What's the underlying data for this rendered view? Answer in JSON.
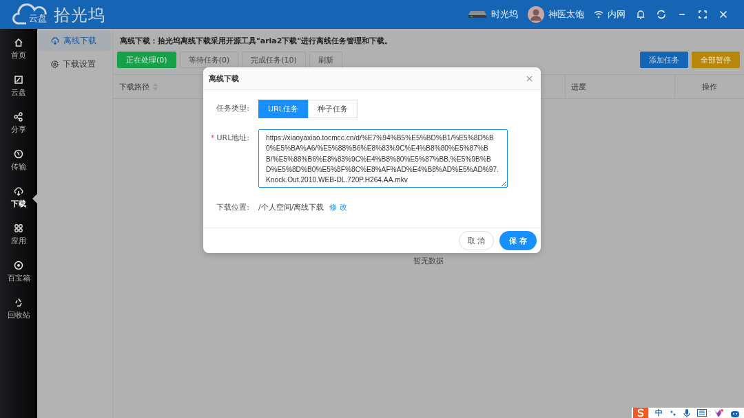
{
  "header": {
    "logo_sub": "云盘",
    "logo_title": "拾光坞",
    "device": "时光坞",
    "user": "神医太饱",
    "network": "内网"
  },
  "nav": [
    {
      "label": "首页",
      "selected": false
    },
    {
      "label": "云盘",
      "selected": false
    },
    {
      "label": "分享",
      "selected": false
    },
    {
      "label": "传输",
      "selected": false
    },
    {
      "label": "下载",
      "selected": true
    },
    {
      "label": "应用",
      "selected": false
    },
    {
      "label": "百宝箱",
      "selected": false
    },
    {
      "label": "回收站",
      "selected": false
    }
  ],
  "subnav": [
    {
      "label": "离线下载",
      "selected": true
    },
    {
      "label": "下载设置",
      "selected": false
    }
  ],
  "description": "离线下载：拾光坞离线下载采用开源工具\"aria2下载\"进行离线任务管理和下载。",
  "filters": [
    {
      "label": "正在处理(0)",
      "selected": true
    },
    {
      "label": "等待任务(0)",
      "selected": false
    },
    {
      "label": "完成任务(10)",
      "selected": false
    }
  ],
  "refresh_button": "刷新",
  "actions": [
    {
      "label": "添加任务",
      "kind": "primary"
    },
    {
      "label": "全部暂停",
      "kind": "warning"
    }
  ],
  "table": {
    "columns": [
      "下载路径",
      "进度",
      "操作"
    ],
    "empty_text": "暂无数据"
  },
  "dialog": {
    "title": "离线下载",
    "task_type_label": "任务类型:",
    "task_types": [
      {
        "label": "URL任务",
        "selected": true
      },
      {
        "label": "种子任务",
        "selected": false
      }
    ],
    "url_label": "URL地址:",
    "required_mark": "*",
    "url": "https://xiaoyaxiao.tocmcc.cn/d/%E7%94%B5%E5%BD%B1/%E5%8D%B0%E5%BA%A6/%E5%88%B6%E8%83%9C%E4%B8%80%E5%87%BB/%E5%88%B6%E8%83%9C%E4%B8%80%E5%87%BB.%E5%9B%BD%E5%8D%B0%E5%8F%8C%E8%AF%AD%E4%B8%AD%E5%AD%97.Knock.Out.2010.WEB-DL.720P.H264.AA.mkv",
    "location_label": "下载位置:",
    "location": "/个人空间/离线下载",
    "change_link": "修 改",
    "cancel": "取 消",
    "save": "保 存"
  },
  "ime": {
    "mode": "中"
  }
}
